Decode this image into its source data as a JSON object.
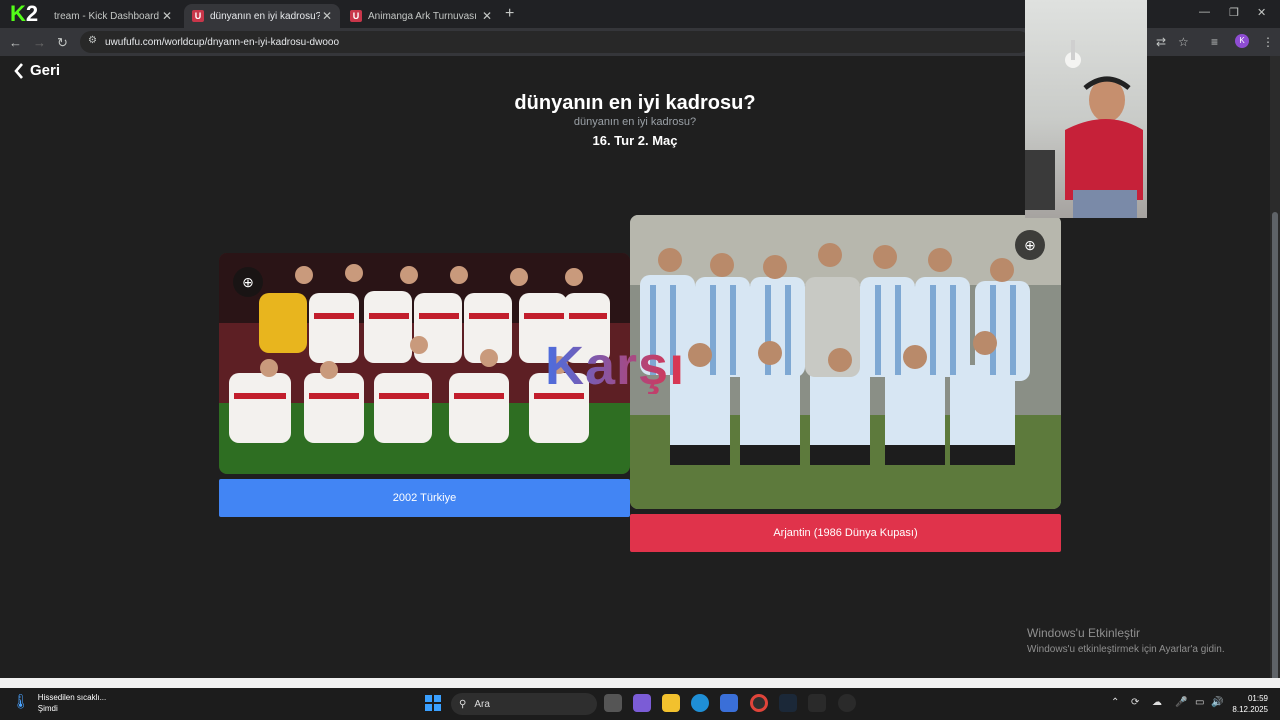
{
  "browser": {
    "tabs": [
      {
        "title": "tream - Kick Dashboard",
        "active": false
      },
      {
        "title": "dünyanın en iyi kadrosu? | UwU",
        "active": true
      },
      {
        "title": "Animanga Ark Turnuvası | UwU",
        "active": false
      }
    ],
    "url": "uwufufu.com/worldcup/dnyann-en-iyi-kadrosu-dwooo",
    "overlay_logo": {
      "k": "K",
      "two": "2"
    }
  },
  "page": {
    "back_label": "Geri",
    "title": "dünyanın en iyi kadrosu?",
    "subtitle": "dünyanın en iyi kadrosu?",
    "round": "16. Tur 2. Maç",
    "versus": "Karşı",
    "left": {
      "label": "2002 Türkiye",
      "color": "#4285f4"
    },
    "right": {
      "label": "Arjantin (1986 Dünya Kupası)",
      "color": "#e0334b"
    }
  },
  "watermark": {
    "line1": "Windows'u Etkinleştir",
    "line2": "Windows'u etkinleştirmek için Ayarlar'a gidin."
  },
  "taskbar": {
    "weather_title": "Hissedilen sıcaklı...",
    "weather_sub": "Şimdi",
    "search_placeholder": "Ara",
    "time": "01:59",
    "date": "8.12.2025"
  }
}
